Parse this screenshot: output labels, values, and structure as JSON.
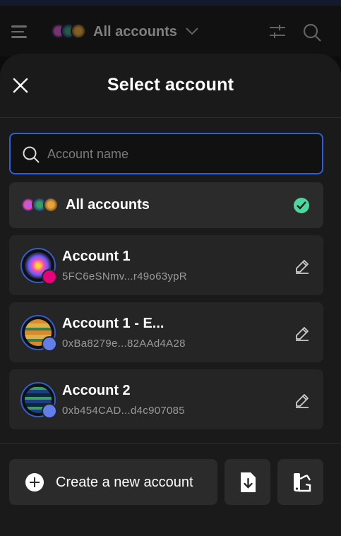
{
  "header": {
    "title": "All accounts"
  },
  "modal": {
    "title": "Select account",
    "search": {
      "placeholder": "Account name",
      "value": ""
    },
    "all_accounts": {
      "label": "All accounts",
      "selected": true
    },
    "accounts": [
      {
        "name": "Account 1",
        "address": "5FC6eSNmv...r49o63ypR",
        "network_icon": "polkadot-icon"
      },
      {
        "name": "Account 1 - E...",
        "address": "0xBa8279e...82AAd4A28",
        "network_icon": "ethereum-icon"
      },
      {
        "name": "Account 2",
        "address": "0xb454CAD...d4c907085",
        "network_icon": "ethereum-icon"
      }
    ],
    "footer": {
      "create_label": "Create a new account",
      "import_icon": "file-import-icon",
      "theme_icon": "swatch-icon"
    }
  },
  "colors": {
    "accent": "#2f5fd0",
    "selected_check": "#4cd6a0",
    "panel": "#1a1a1a",
    "row": "#252525"
  }
}
